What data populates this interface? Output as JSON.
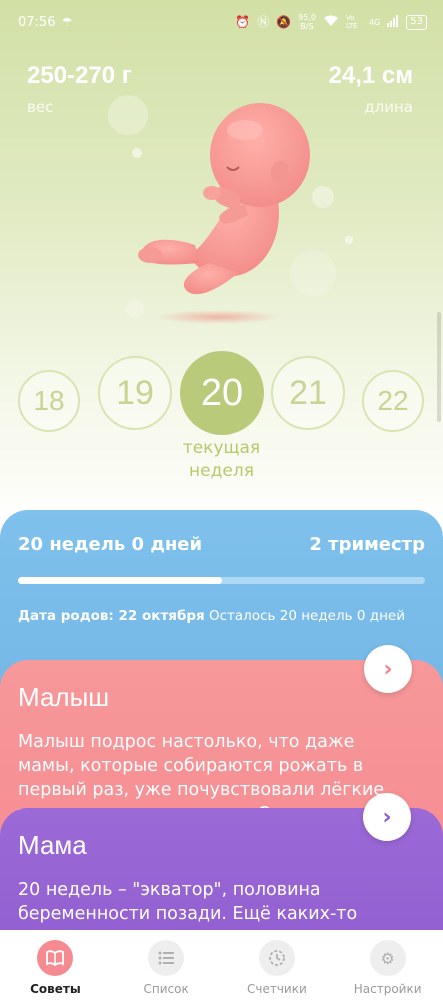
{
  "status_bar": {
    "time": "07:56",
    "speed_value": "95,0",
    "speed_unit": "B/S",
    "network": "Vo LTE",
    "signal": "4G",
    "battery": "53"
  },
  "stats": {
    "weight": {
      "value": "250-270 г",
      "label": "вес"
    },
    "length": {
      "value": "24,1 см",
      "label": "длина"
    }
  },
  "weeks": [
    "18",
    "19",
    "20",
    "21",
    "22"
  ],
  "current_week_index": 2,
  "current_week_caption": "текущая неделя",
  "pregnancy": {
    "duration": "20 недель 0 дней",
    "trimester": "2 триместр",
    "progress": 0.5,
    "due_label": "Дата родов: 22 октября",
    "remaining": "Осталось 20 недель 0 дней"
  },
  "cards": {
    "baby": {
      "title": "Малыш",
      "text": "Малыш подрос настолько, что даже мамы, которые собираются рожать в первый раз, уже почувствовали лёгкие толчки и прикосновения. Совсем скоро"
    },
    "mom": {
      "title": "Мама",
      "text": "20 недель – \"экватор\", половина беременности позади. Ещё каких-то"
    }
  },
  "tabs": [
    {
      "label": "Советы",
      "icon": "book-icon",
      "active": true
    },
    {
      "label": "Список",
      "icon": "list-icon",
      "active": false
    },
    {
      "label": "Счетчики",
      "icon": "timer-icon",
      "active": false
    },
    {
      "label": "Настройки",
      "icon": "gear-icon",
      "active": false
    }
  ],
  "colors": {
    "accent_green": "#b9cb7a",
    "info_blue": "#7fc1ec",
    "baby_pink": "#f58b91",
    "mom_purple": "#9c6ad7"
  }
}
